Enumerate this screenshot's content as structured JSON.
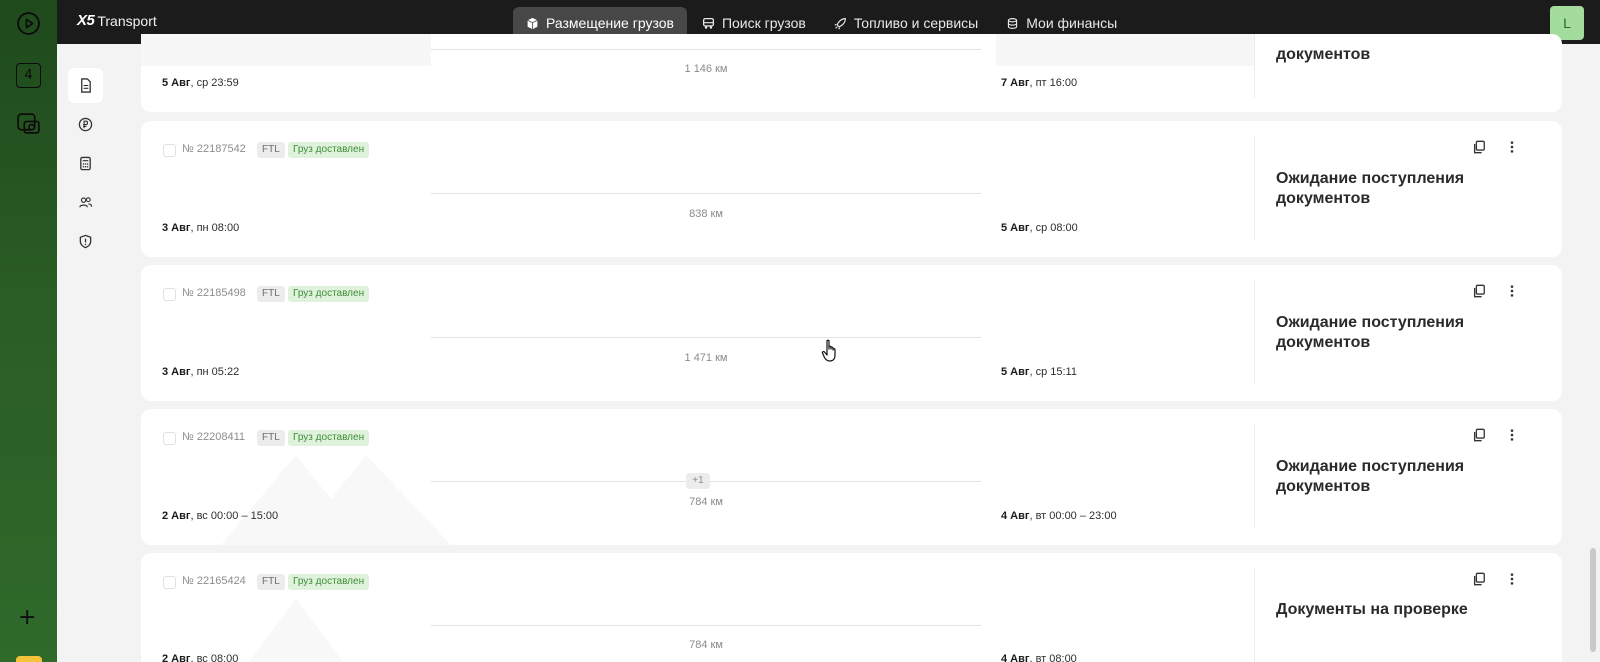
{
  "os_rail": {
    "badge": "4"
  },
  "topbar": {
    "logo_mark": "X5",
    "logo_text": "Transport",
    "nav": [
      {
        "label": "Размещение грузов",
        "icon": "box-icon",
        "active": true
      },
      {
        "label": "Поиск грузов",
        "icon": "truck-icon",
        "active": false
      },
      {
        "label": "Топливо и сервисы",
        "icon": "rocket-icon",
        "active": false
      },
      {
        "label": "Мои финансы",
        "icon": "coins-icon",
        "active": false
      }
    ],
    "avatar": "L"
  },
  "sidebar": [
    {
      "icon": "document-icon"
    },
    {
      "icon": "ruble-icon"
    },
    {
      "icon": "calculator-icon"
    },
    {
      "icon": "users-icon"
    },
    {
      "icon": "shield-icon"
    }
  ],
  "cards": [
    {
      "number": "",
      "distance": "1 146 км",
      "from_day": "5 Авг",
      "from_rest": ", ср 23:59",
      "to_day": "7 Авг",
      "to_rest": ", пт 16:00",
      "status": "документов"
    },
    {
      "number": "№ 22187542",
      "type": "FTL",
      "badge": "Груз доставлен",
      "distance": "838 км",
      "from_day": "3 Авг",
      "from_rest": ", пн 08:00",
      "to_day": "5 Авг",
      "to_rest": ", ср 08:00",
      "status": "Ожидание поступления документов"
    },
    {
      "number": "№ 22185498",
      "type": "FTL",
      "badge": "Груз доставлен",
      "distance": "1 471 км",
      "from_day": "3 Авг",
      "from_rest": ", пн 05:22",
      "to_day": "5 Авг",
      "to_rest": ", ср 15:11",
      "status": "Ожидание поступления документов"
    },
    {
      "number": "№ 22208411",
      "type": "FTL",
      "badge": "Груз доставлен",
      "extra_stops": "+1",
      "distance": "784 км",
      "from_day": "2 Авг",
      "from_rest": ", вс 00:00 – 15:00",
      "to_day": "4 Авг",
      "to_rest": ", вт 00:00 – 23:00",
      "status": "Ожидание поступления документов"
    },
    {
      "number": "№ 22165424",
      "type": "FTL",
      "badge": "Груз доставлен",
      "distance": "784 км",
      "from_day": "2 Авг",
      "from_rest": ", вс 08:00",
      "to_day": "4 Авг",
      "to_rest": ", вт 08:00",
      "status": "Документы на проверке"
    }
  ]
}
